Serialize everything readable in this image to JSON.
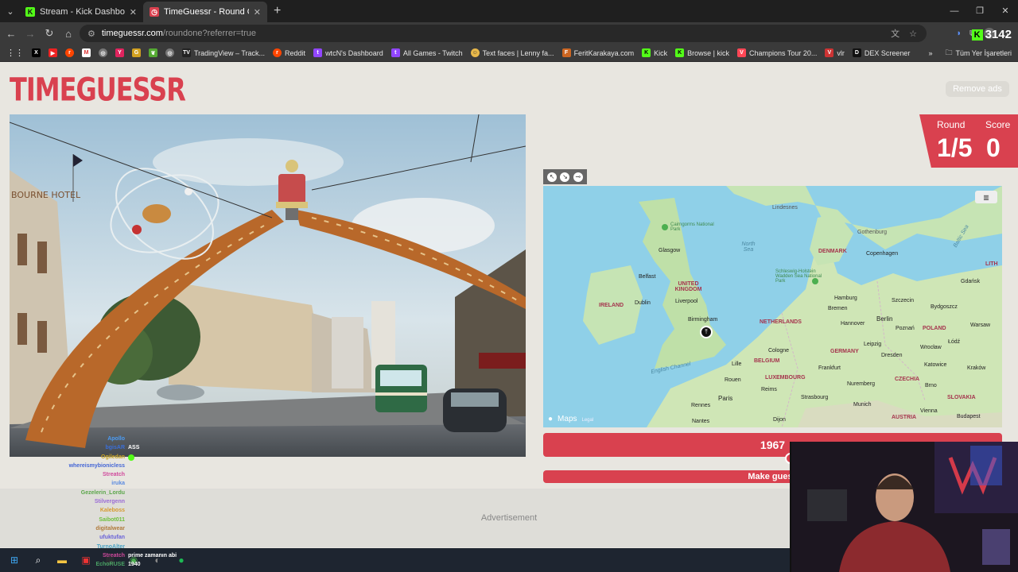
{
  "browser": {
    "tabs": [
      {
        "label": "Stream - Kick Dashboard",
        "favicon": "kick-icon",
        "color": "#53fc18",
        "active": false
      },
      {
        "label": "TimeGuessr - Round One",
        "favicon": "timeguessr-icon",
        "color": "#d9414f",
        "active": true
      }
    ],
    "new_tab": "+",
    "url_host": "timeguessr.com",
    "url_path": "/roundone?referrer=true",
    "kick_viewers": "3142",
    "bookmarks": [
      {
        "label": "",
        "icon": "x-icon"
      },
      {
        "label": "",
        "icon": "youtube-icon"
      },
      {
        "label": "",
        "icon": "reddit-icon"
      },
      {
        "label": "",
        "icon": "gmail-icon"
      },
      {
        "label": "",
        "icon": "globe-icon"
      },
      {
        "label": "",
        "icon": "y-icon"
      },
      {
        "label": "",
        "icon": "g-icon"
      },
      {
        "label": "",
        "icon": "leaf-icon"
      },
      {
        "label": "",
        "icon": "globe-icon"
      },
      {
        "label": "TradingView – Track...",
        "icon": "tradingview-icon"
      },
      {
        "label": "Reddit",
        "icon": "reddit-icon"
      },
      {
        "label": "wtcN's Dashboard",
        "icon": "twitch-icon"
      },
      {
        "label": "All Games - Twitch",
        "icon": "twitch-icon"
      },
      {
        "label": "Text faces | Lenny fa...",
        "icon": "face-icon"
      },
      {
        "label": "FeritKarakaya.com",
        "icon": "fk-icon"
      },
      {
        "label": "Kick",
        "icon": "kick-icon"
      },
      {
        "label": "Browse | kick",
        "icon": "kick-icon"
      },
      {
        "label": "Champions Tour 20...",
        "icon": "valorant-icon"
      },
      {
        "label": "vlr",
        "icon": "vlr-icon"
      },
      {
        "label": "DEX Screener",
        "icon": "dex-icon"
      }
    ],
    "more_bookmarks": "»",
    "all_bookmarks": "Tüm Yer İşaretleri"
  },
  "page": {
    "logo": "TIMEGUESSR",
    "remove_ads": "Remove ads",
    "round_label": "Round",
    "score_label": "Score",
    "round_value": "1/5",
    "score_value": "0",
    "year_value": "1967",
    "guess_button": "Make guess",
    "advertisement": "Advertisement",
    "map": {
      "brand": "Maps",
      "legal": "Legal",
      "labels": {
        "lindesnes": "Lindesnes",
        "gothenburg": "Gothenburg",
        "cairngorms": "Cairngorms National Park",
        "north_sea": "North Sea",
        "glasgow": "Glasgow",
        "denmark": "DENMARK",
        "copenhagen": "Copenhagen",
        "belfast": "Belfast",
        "uk": "UNITED KINGDOM",
        "schleswig": "Schleswig-Holstein Wadden Sea National Park",
        "ireland": "IRELAND",
        "dublin": "Dublin",
        "liverpool": "Liverpool",
        "hamburg": "Hamburg",
        "szczecin": "Szczecin",
        "gdansk": "Gdańsk",
        "bremen": "Bremen",
        "bydgoszcz": "Bydgoszcz",
        "birmingham": "Birmingham",
        "netherlands": "NETHERLANDS",
        "hannover": "Hannover",
        "berlin": "Berlin",
        "poznan": "Poznań",
        "poland": "POLAND",
        "warsaw": "Warsaw",
        "lodz": "Łódź",
        "cologne": "Cologne",
        "leipzig": "Leipzig",
        "wroclaw": "Wrocław",
        "germany": "GERMANY",
        "dresden": "Dresden",
        "belgium": "BELGIUM",
        "lille": "Lille",
        "frankfurt": "Frankfurt",
        "katowice": "Katowice",
        "krakow": "Kraków",
        "english_channel": "English Channel",
        "luxembourg": "LUXEMBOURG",
        "rouen": "Rouen",
        "reims": "Reims",
        "nuremberg": "Nuremberg",
        "czechia": "CZECHIA",
        "brno": "Brno",
        "paris": "Paris",
        "strasbourg": "Strasbourg",
        "slovakia": "SLOVAKIA",
        "rennes": "Rennes",
        "munich": "Munich",
        "vienna": "Vienna",
        "budapest": "Budapest",
        "nantes": "Nantes",
        "dijon": "Dijon",
        "austria": "AUSTRIA",
        "lith": "LITH",
        "baltic": "Baltic Sea"
      }
    }
  },
  "chat": [
    {
      "user": "Apollo",
      "msg": "",
      "color": "#4b9cf5"
    },
    {
      "user": "bgisAR",
      "msg": "ASS",
      "color": "#3b6fd8",
      "bright": true
    },
    {
      "user": "Ogiledan",
      "msg": "",
      "color": "#c7a325"
    },
    {
      "user": "whereismybionicless",
      "msg": "",
      "color": "#4466d6"
    },
    {
      "user": "Streatch",
      "msg": "",
      "color": "#d04a9c"
    },
    {
      "user": "iruka",
      "msg": "",
      "color": "#5a8ae0"
    },
    {
      "user": "Gezelerin_Lordu",
      "msg": "",
      "color": "#5ba64a"
    },
    {
      "user": "Stilvergenn",
      "msg": "",
      "color": "#9b6bd6"
    },
    {
      "user": "Kaleboss",
      "msg": "",
      "color": "#d69a2e"
    },
    {
      "user": "Saibot011",
      "msg": "",
      "color": "#6dbf3c"
    },
    {
      "user": "digitalwear",
      "msg": "",
      "color": "#b07a3a"
    },
    {
      "user": "ufuktufan",
      "msg": "",
      "color": "#6a63d8"
    },
    {
      "user": "TurnoAlter",
      "msg": "",
      "color": "#4aa3c6"
    },
    {
      "user": "Streatch",
      "msg": "prime zamanın abi",
      "color": "#d04a9c",
      "bright": true
    },
    {
      "user": "EchoRUSE",
      "msg": "1940",
      "color": "#4aa365",
      "bright": true
    }
  ],
  "taskbar": [
    "windows-icon",
    "search-icon",
    "explorer-icon",
    "app-icon",
    "app-icon",
    "chrome-icon",
    "app-icon",
    "spotify-icon"
  ]
}
